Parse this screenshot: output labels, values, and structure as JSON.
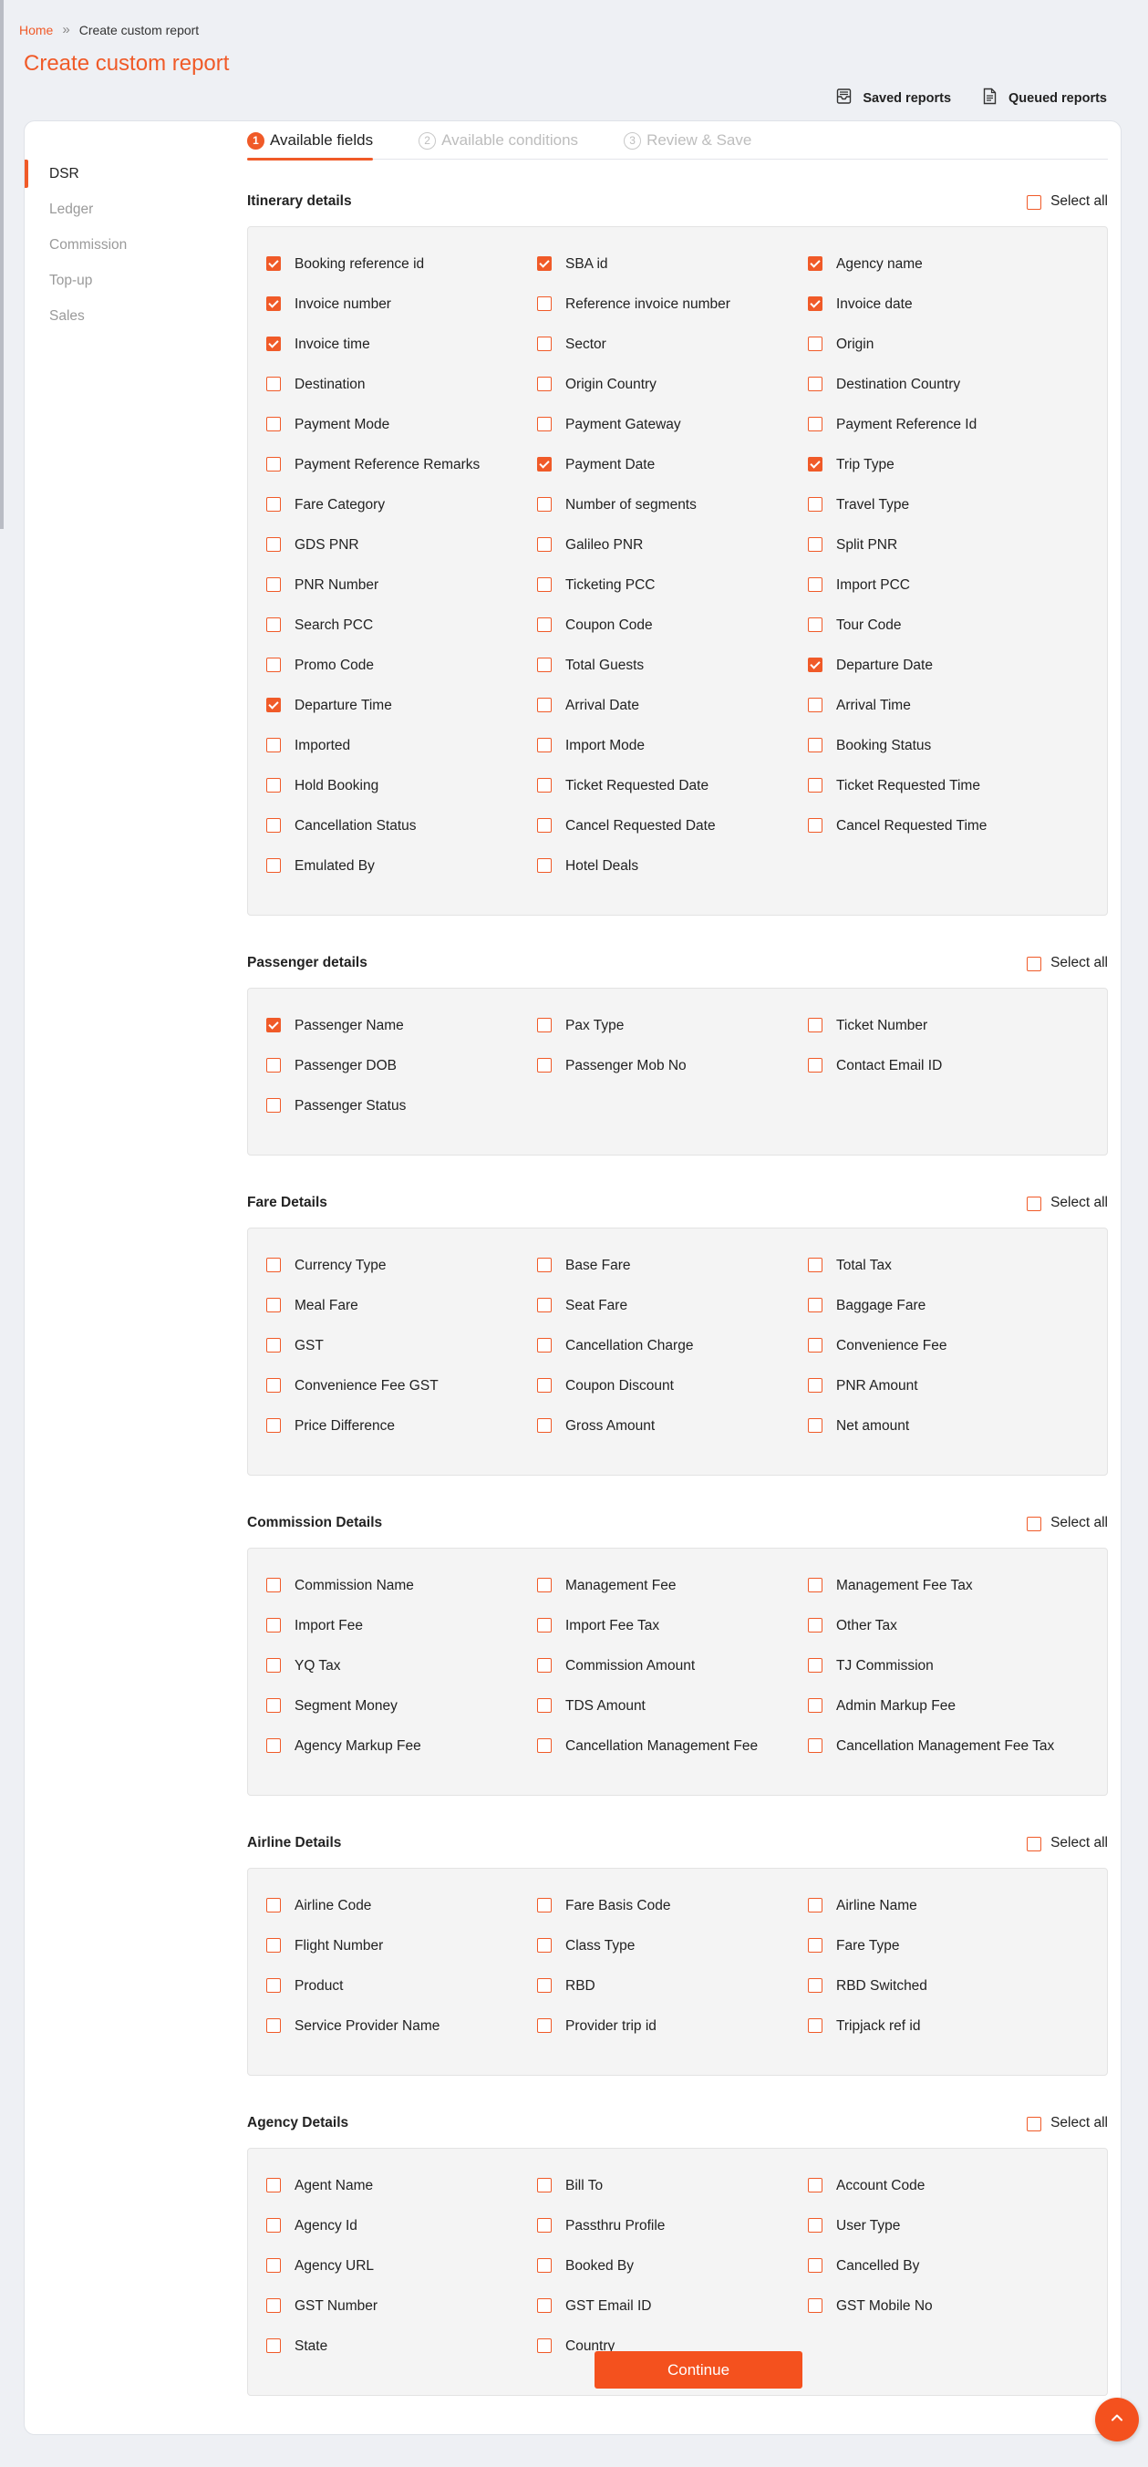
{
  "breadcrumb": {
    "home": "Home",
    "current": "Create custom report"
  },
  "page_title": "Create custom report",
  "top_links": {
    "saved": "Saved reports",
    "queued": "Queued reports"
  },
  "sidebar": {
    "items": [
      {
        "label": "DSR",
        "active": true
      },
      {
        "label": "Ledger",
        "active": false
      },
      {
        "label": "Commission",
        "active": false
      },
      {
        "label": "Top-up",
        "active": false
      },
      {
        "label": "Sales",
        "active": false
      }
    ]
  },
  "steps": [
    {
      "num": "1",
      "label": "Available fields",
      "active": true
    },
    {
      "num": "2",
      "label": "Available conditions",
      "active": false
    },
    {
      "num": "3",
      "label": "Review & Save",
      "active": false
    }
  ],
  "select_all_label": "Select all",
  "sections": [
    {
      "title": "Itinerary details",
      "fields": [
        {
          "label": "Booking reference id",
          "checked": true
        },
        {
          "label": "SBA id",
          "checked": true
        },
        {
          "label": "Agency name",
          "checked": true
        },
        {
          "label": "Invoice number",
          "checked": true
        },
        {
          "label": "Reference invoice number",
          "checked": false
        },
        {
          "label": "Invoice date",
          "checked": true
        },
        {
          "label": "Invoice time",
          "checked": true
        },
        {
          "label": "Sector",
          "checked": false
        },
        {
          "label": "Origin",
          "checked": false
        },
        {
          "label": "Destination",
          "checked": false
        },
        {
          "label": "Origin Country",
          "checked": false
        },
        {
          "label": "Destination Country",
          "checked": false
        },
        {
          "label": "Payment Mode",
          "checked": false
        },
        {
          "label": "Payment Gateway",
          "checked": false
        },
        {
          "label": "Payment Reference Id",
          "checked": false
        },
        {
          "label": "Payment Reference Remarks",
          "checked": false
        },
        {
          "label": "Payment Date",
          "checked": true
        },
        {
          "label": "Trip Type",
          "checked": true
        },
        {
          "label": "Fare Category",
          "checked": false
        },
        {
          "label": "Number of segments",
          "checked": false
        },
        {
          "label": "Travel Type",
          "checked": false
        },
        {
          "label": "GDS PNR",
          "checked": false
        },
        {
          "label": "Galileo PNR",
          "checked": false
        },
        {
          "label": "Split PNR",
          "checked": false
        },
        {
          "label": "PNR Number",
          "checked": false
        },
        {
          "label": "Ticketing PCC",
          "checked": false
        },
        {
          "label": "Import PCC",
          "checked": false
        },
        {
          "label": "Search PCC",
          "checked": false
        },
        {
          "label": "Coupon Code",
          "checked": false
        },
        {
          "label": "Tour Code",
          "checked": false
        },
        {
          "label": "Promo Code",
          "checked": false
        },
        {
          "label": "Total Guests",
          "checked": false
        },
        {
          "label": "Departure Date",
          "checked": true
        },
        {
          "label": "Departure Time",
          "checked": true
        },
        {
          "label": "Arrival Date",
          "checked": false
        },
        {
          "label": "Arrival Time",
          "checked": false
        },
        {
          "label": "Imported",
          "checked": false
        },
        {
          "label": "Import Mode",
          "checked": false
        },
        {
          "label": "Booking Status",
          "checked": false
        },
        {
          "label": "Hold Booking",
          "checked": false
        },
        {
          "label": "Ticket Requested Date",
          "checked": false
        },
        {
          "label": "Ticket Requested Time",
          "checked": false
        },
        {
          "label": "Cancellation Status",
          "checked": false
        },
        {
          "label": "Cancel Requested Date",
          "checked": false
        },
        {
          "label": "Cancel Requested Time",
          "checked": false
        },
        {
          "label": "Emulated By",
          "checked": false
        },
        {
          "label": "Hotel Deals",
          "checked": false
        }
      ]
    },
    {
      "title": "Passenger details",
      "fields": [
        {
          "label": "Passenger Name",
          "checked": true
        },
        {
          "label": "Pax Type",
          "checked": false
        },
        {
          "label": "Ticket Number",
          "checked": false
        },
        {
          "label": "Passenger DOB",
          "checked": false
        },
        {
          "label": "Passenger Mob No",
          "checked": false
        },
        {
          "label": "Contact Email ID",
          "checked": false
        },
        {
          "label": "Passenger Status",
          "checked": false
        }
      ]
    },
    {
      "title": "Fare Details",
      "fields": [
        {
          "label": "Currency Type",
          "checked": false
        },
        {
          "label": "Base Fare",
          "checked": false
        },
        {
          "label": "Total Tax",
          "checked": false
        },
        {
          "label": "Meal Fare",
          "checked": false
        },
        {
          "label": "Seat Fare",
          "checked": false
        },
        {
          "label": "Baggage Fare",
          "checked": false
        },
        {
          "label": "GST",
          "checked": false
        },
        {
          "label": "Cancellation Charge",
          "checked": false
        },
        {
          "label": "Convenience Fee",
          "checked": false
        },
        {
          "label": "Convenience Fee GST",
          "checked": false
        },
        {
          "label": "Coupon Discount",
          "checked": false
        },
        {
          "label": "PNR Amount",
          "checked": false
        },
        {
          "label": "Price Difference",
          "checked": false
        },
        {
          "label": "Gross Amount",
          "checked": false
        },
        {
          "label": "Net amount",
          "checked": false
        }
      ]
    },
    {
      "title": "Commission Details",
      "fields": [
        {
          "label": "Commission Name",
          "checked": false
        },
        {
          "label": "Management Fee",
          "checked": false
        },
        {
          "label": "Management Fee Tax",
          "checked": false
        },
        {
          "label": "Import Fee",
          "checked": false
        },
        {
          "label": "Import Fee Tax",
          "checked": false
        },
        {
          "label": "Other Tax",
          "checked": false
        },
        {
          "label": "YQ Tax",
          "checked": false
        },
        {
          "label": "Commission Amount",
          "checked": false
        },
        {
          "label": "TJ Commission",
          "checked": false
        },
        {
          "label": "Segment Money",
          "checked": false
        },
        {
          "label": "TDS Amount",
          "checked": false
        },
        {
          "label": "Admin Markup Fee",
          "checked": false
        },
        {
          "label": "Agency Markup Fee",
          "checked": false
        },
        {
          "label": "Cancellation Management Fee",
          "checked": false
        },
        {
          "label": "Cancellation Management Fee Tax",
          "checked": false
        }
      ]
    },
    {
      "title": "Airline Details",
      "fields": [
        {
          "label": "Airline Code",
          "checked": false
        },
        {
          "label": "Fare Basis Code",
          "checked": false
        },
        {
          "label": "Airline Name",
          "checked": false
        },
        {
          "label": "Flight Number",
          "checked": false
        },
        {
          "label": "Class Type",
          "checked": false
        },
        {
          "label": "Fare Type",
          "checked": false
        },
        {
          "label": "Product",
          "checked": false
        },
        {
          "label": "RBD",
          "checked": false
        },
        {
          "label": "RBD Switched",
          "checked": false
        },
        {
          "label": "Service Provider Name",
          "checked": false
        },
        {
          "label": "Provider trip id",
          "checked": false
        },
        {
          "label": "Tripjack ref id",
          "checked": false
        }
      ]
    },
    {
      "title": "Agency Details",
      "fields": [
        {
          "label": "Agent Name",
          "checked": false
        },
        {
          "label": "Bill To",
          "checked": false
        },
        {
          "label": "Account Code",
          "checked": false
        },
        {
          "label": "Agency Id",
          "checked": false
        },
        {
          "label": "Passthru Profile",
          "checked": false
        },
        {
          "label": "User Type",
          "checked": false
        },
        {
          "label": "Agency URL",
          "checked": false
        },
        {
          "label": "Booked By",
          "checked": false
        },
        {
          "label": "Cancelled By",
          "checked": false
        },
        {
          "label": "GST Number",
          "checked": false
        },
        {
          "label": "GST Email ID",
          "checked": false
        },
        {
          "label": "GST Mobile No",
          "checked": false
        },
        {
          "label": "State",
          "checked": false
        },
        {
          "label": "Country",
          "checked": false
        }
      ]
    }
  ],
  "continue_label": "Continue",
  "colors": {
    "accent": "#f05a28",
    "button": "#f4511e",
    "panel": "#f4f4f4",
    "page_bg": "#eef0f4"
  }
}
